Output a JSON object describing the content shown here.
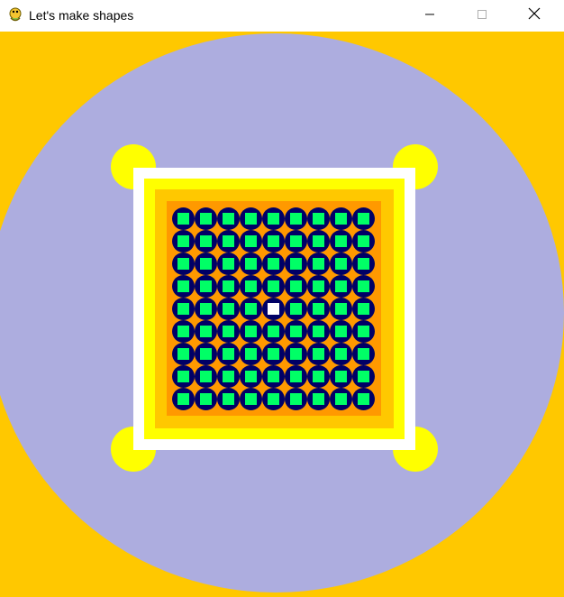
{
  "window": {
    "title": "Let's make shapes",
    "controls": {
      "minimize_icon": "minimize-icon",
      "maximize_icon": "maximize-icon",
      "close_icon": "close-icon"
    }
  },
  "canvas": {
    "colors": {
      "background": "#ffc800",
      "big_circle": "#adaddf",
      "corner_dots": "#ffff00",
      "outer_frame": "#ffffff",
      "middle_frame": "#ffff00",
      "inner_frame": "#ffc800",
      "grid_field": "#ff9900",
      "cell_circle": "#000066",
      "cell_square": "#00ff66",
      "highlight_square": "#ffffff"
    },
    "grid": {
      "rows": 9,
      "cols": 9,
      "highlight": {
        "row": 4,
        "col": 4
      }
    }
  }
}
